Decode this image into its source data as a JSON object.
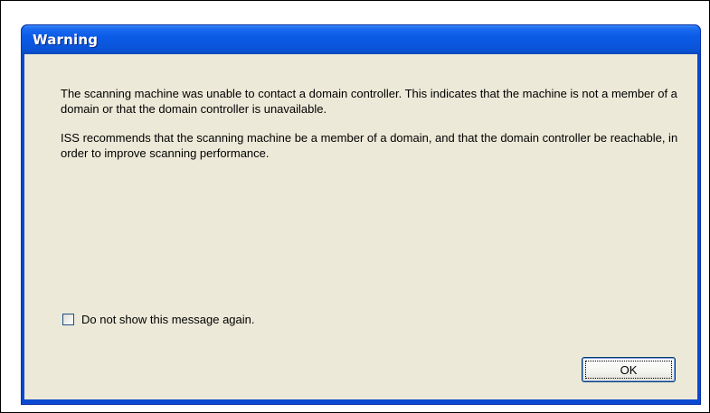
{
  "window": {
    "title": "Warning"
  },
  "message": {
    "paragraph1": "The scanning machine was unable to contact a domain controller.  This indicates that the machine is not a member of a domain or that the domain controller is unavailable.",
    "paragraph2": "ISS recommends that the scanning machine be a member of a domain, and that the domain controller be reachable, in order to improve scanning performance."
  },
  "options": {
    "dont_show_again": {
      "label": "Do not show this message again.",
      "checked": false
    }
  },
  "buttons": {
    "ok_label": "OK"
  },
  "colors": {
    "titlebar": "#0a57e0",
    "client_background": "#ece9d8"
  }
}
